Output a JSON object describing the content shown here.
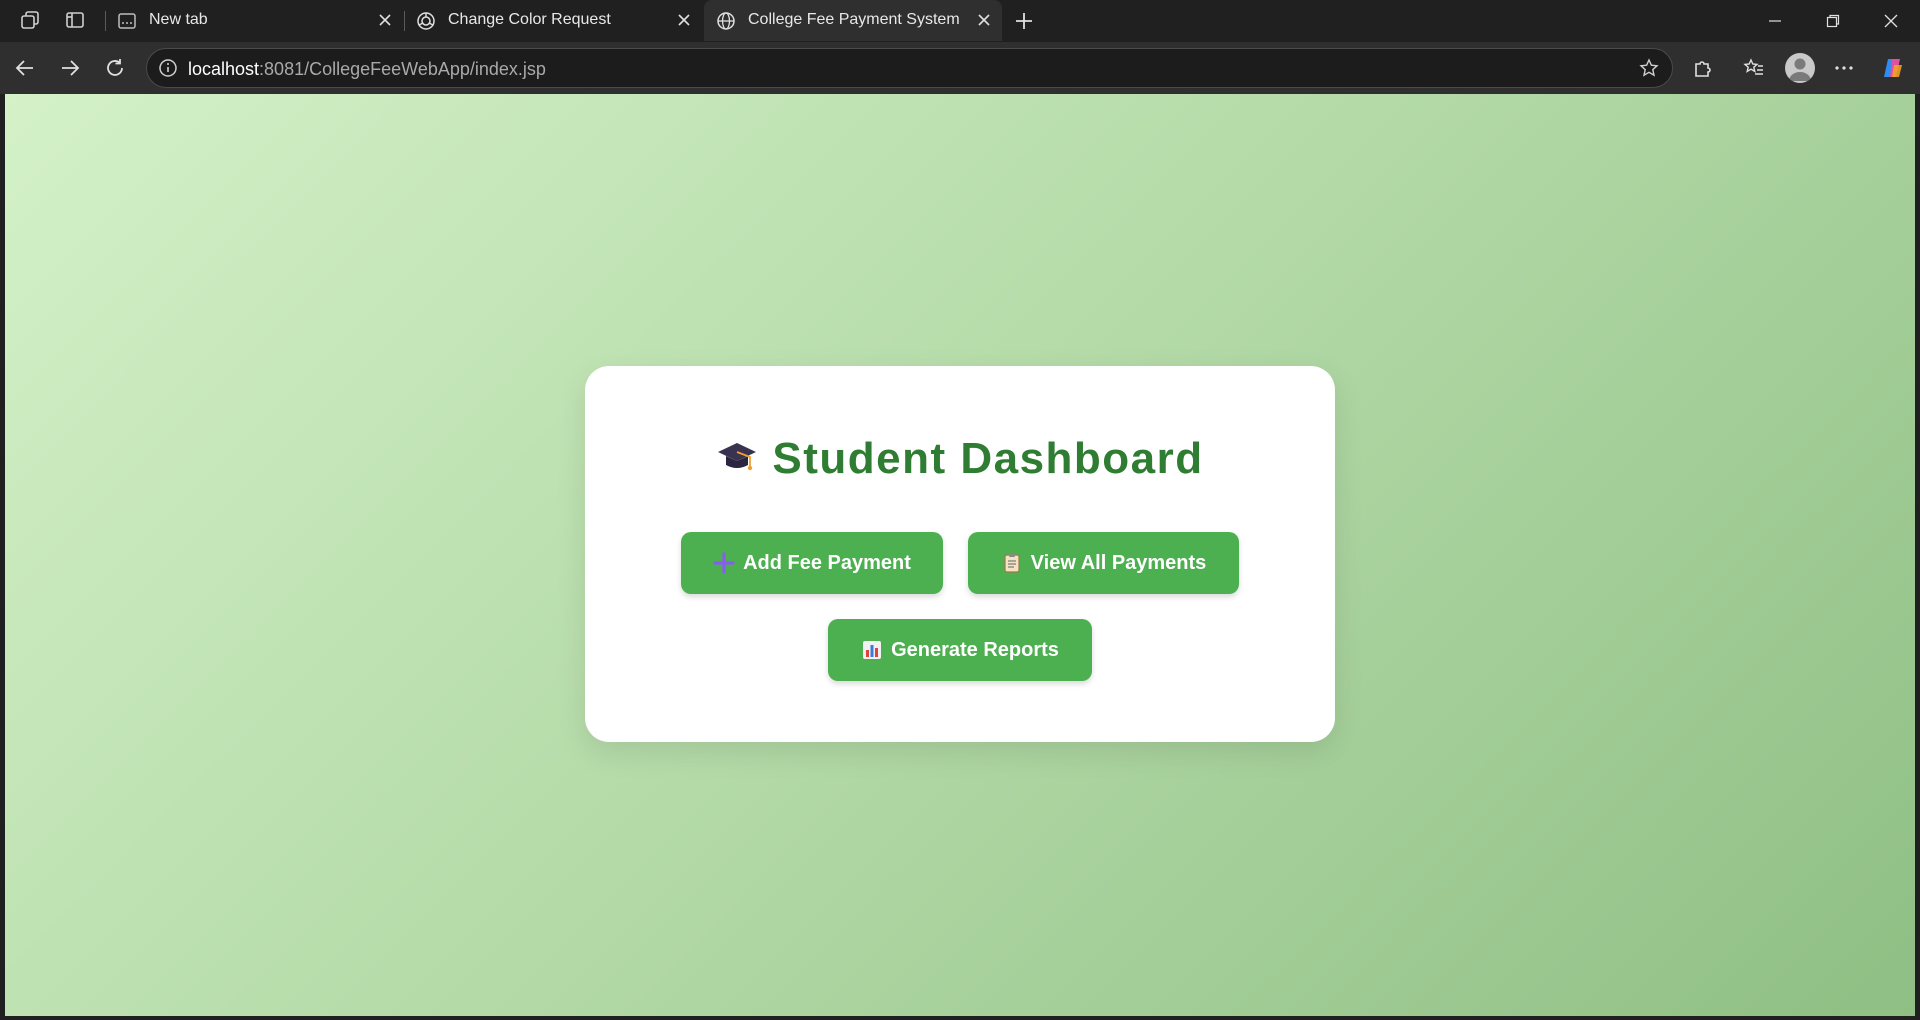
{
  "browser": {
    "tabs": [
      {
        "title": "New tab"
      },
      {
        "title": "Change Color Request"
      },
      {
        "title": "College Fee Payment System"
      }
    ],
    "address": {
      "host": "localhost",
      "rest": ":8081/CollegeFeeWebApp/index.jsp"
    }
  },
  "page": {
    "title": "Student Dashboard",
    "buttons": {
      "add_payment": "Add Fee Payment",
      "view_payments": "View All Payments",
      "reports": "Generate Reports"
    }
  },
  "colors": {
    "accent_green": "#4caf50",
    "title_green": "#2e7d32"
  },
  "icons": [
    "workspaces-icon",
    "vertical-tabs-icon",
    "graduation-cap-icon",
    "plus-icon",
    "clipboard-icon",
    "bar-chart-icon"
  ]
}
